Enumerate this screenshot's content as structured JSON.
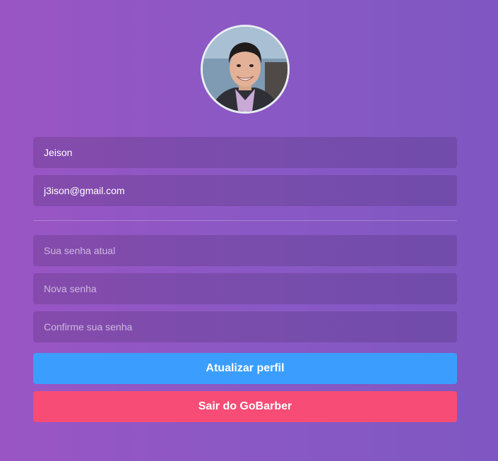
{
  "profile": {
    "avatar_alt": "Jeison",
    "name_value": "Jeison",
    "email_value": "j3ison@gmail.com"
  },
  "passwords": {
    "old_placeholder": "Sua senha atual",
    "new_placeholder": "Nova senha",
    "confirm_placeholder": "Confirme sua senha"
  },
  "actions": {
    "update_label": "Atualizar perfil",
    "logout_label": "Sair do GoBarber"
  },
  "colors": {
    "update_button": "#3b9eff",
    "logout_button": "#f64c75"
  },
  "icons": {
    "avatar": "avatar-photo"
  }
}
